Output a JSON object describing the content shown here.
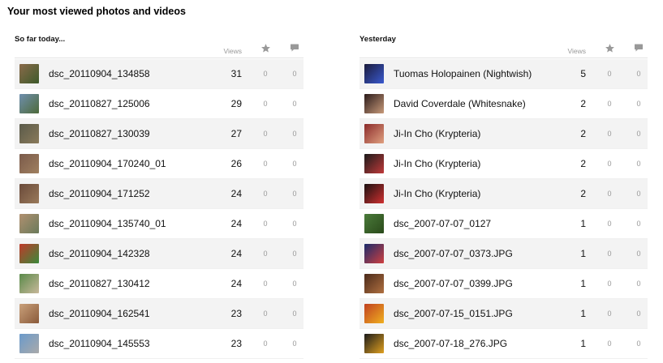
{
  "page_title": "Your most viewed photos and videos",
  "icons": {
    "favorites": "star-icon",
    "comments": "comment-icon"
  },
  "panels": [
    {
      "title": "So far today...",
      "views_label": "Views",
      "rows": [
        {
          "name": "dsc_20110904_134858",
          "views": "31",
          "favorites": "0",
          "comments": "0",
          "thumb": [
            "#8a6a4a",
            "#3d5a2a"
          ]
        },
        {
          "name": "dsc_20110827_125006",
          "views": "29",
          "favorites": "0",
          "comments": "0",
          "thumb": [
            "#6f8fae",
            "#4d6a3a"
          ]
        },
        {
          "name": "dsc_20110827_130039",
          "views": "27",
          "favorites": "0",
          "comments": "0",
          "thumb": [
            "#5a5a4a",
            "#8a7a5a"
          ]
        },
        {
          "name": "dsc_20110904_170240_01",
          "views": "26",
          "favorites": "0",
          "comments": "0",
          "thumb": [
            "#7a5a4a",
            "#a08060"
          ]
        },
        {
          "name": "dsc_20110904_171252",
          "views": "24",
          "favorites": "0",
          "comments": "0",
          "thumb": [
            "#6a4a3a",
            "#9a7a5a"
          ]
        },
        {
          "name": "dsc_20110904_135740_01",
          "views": "24",
          "favorites": "0",
          "comments": "0",
          "thumb": [
            "#b09070",
            "#6a7a5a"
          ]
        },
        {
          "name": "dsc_20110904_142328",
          "views": "24",
          "favorites": "0",
          "comments": "0",
          "thumb": [
            "#c03a2a",
            "#3a8a3a"
          ]
        },
        {
          "name": "dsc_20110827_130412",
          "views": "24",
          "favorites": "0",
          "comments": "0",
          "thumb": [
            "#5a8a4a",
            "#c8b89a"
          ]
        },
        {
          "name": "dsc_20110904_162541",
          "views": "23",
          "favorites": "0",
          "comments": "0",
          "thumb": [
            "#c9a07a",
            "#8a5a3a"
          ]
        },
        {
          "name": "dsc_20110904_145553",
          "views": "23",
          "favorites": "0",
          "comments": "0",
          "thumb": [
            "#6a9acb",
            "#aaaaaa"
          ]
        }
      ]
    },
    {
      "title": "Yesterday",
      "views_label": "Views",
      "rows": [
        {
          "name": "Tuomas Holopainen (Nightwish)",
          "views": "5",
          "favorites": "0",
          "comments": "0",
          "thumb": [
            "#1a1a3a",
            "#3a5acf"
          ]
        },
        {
          "name": "David Coverdale (Whitesnake)",
          "views": "2",
          "favorites": "0",
          "comments": "0",
          "thumb": [
            "#2a1a1a",
            "#c89a7a"
          ]
        },
        {
          "name": "Ji-In Cho (Krypteria)",
          "views": "2",
          "favorites": "0",
          "comments": "0",
          "thumb": [
            "#8a2a2a",
            "#e0a080"
          ]
        },
        {
          "name": "Ji-In Cho (Krypteria)",
          "views": "2",
          "favorites": "0",
          "comments": "0",
          "thumb": [
            "#1a1a1a",
            "#c03a3a"
          ]
        },
        {
          "name": "Ji-In Cho (Krypteria)",
          "views": "2",
          "favorites": "0",
          "comments": "0",
          "thumb": [
            "#1a1010",
            "#d03030"
          ]
        },
        {
          "name": "dsc_2007-07-07_0127",
          "views": "1",
          "favorites": "0",
          "comments": "0",
          "thumb": [
            "#4a7a3a",
            "#2a4a1a"
          ]
        },
        {
          "name": "dsc_2007-07-07_0373.JPG",
          "views": "1",
          "favorites": "0",
          "comments": "0",
          "thumb": [
            "#1a2a6a",
            "#d04040"
          ]
        },
        {
          "name": "dsc_2007-07-07_0399.JPG",
          "views": "1",
          "favorites": "0",
          "comments": "0",
          "thumb": [
            "#4a2a1a",
            "#b07040"
          ]
        },
        {
          "name": "dsc_2007-07-15_0151.JPG",
          "views": "1",
          "favorites": "0",
          "comments": "0",
          "thumb": [
            "#c04020",
            "#f0b020"
          ]
        },
        {
          "name": "dsc_2007-07-18_276.JPG",
          "views": "1",
          "favorites": "0",
          "comments": "0",
          "thumb": [
            "#1a1a1a",
            "#e0a020"
          ]
        }
      ]
    }
  ]
}
